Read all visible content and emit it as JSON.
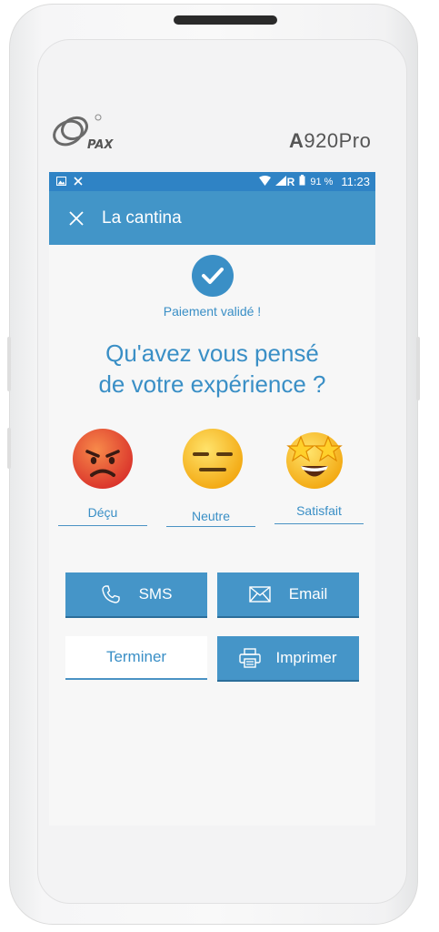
{
  "device": {
    "brand": "PAX",
    "model_bold": "A",
    "model_rest": "920Pro"
  },
  "status_bar": {
    "left_icons": [
      "image-icon",
      "mute-icon"
    ],
    "wifi_icon": "wifi-icon",
    "signal_label": "R",
    "battery_icon": "battery-icon",
    "battery": "91 %",
    "time": "11:23"
  },
  "app_bar": {
    "close_icon": "✕",
    "title": "La cantina"
  },
  "payment": {
    "status": "Paiement validé !"
  },
  "survey": {
    "question_line1": "Qu'avez vous pensé",
    "question_line2": "de votre expérience ?",
    "options": [
      {
        "label": "Déçu",
        "icon": "angry-face-icon"
      },
      {
        "label": "Neutre",
        "icon": "neutral-face-icon"
      },
      {
        "label": "Satisfait",
        "icon": "star-struck-face-icon"
      }
    ]
  },
  "actions": {
    "sms_label": "SMS",
    "email_label": "Email",
    "finish_label": "Terminer",
    "print_label": "Imprimer"
  },
  "colors": {
    "status_bar": "#2f83c5",
    "app_bar": "#4295c8",
    "accent": "#3a8fc6",
    "button": "#4595c8"
  }
}
